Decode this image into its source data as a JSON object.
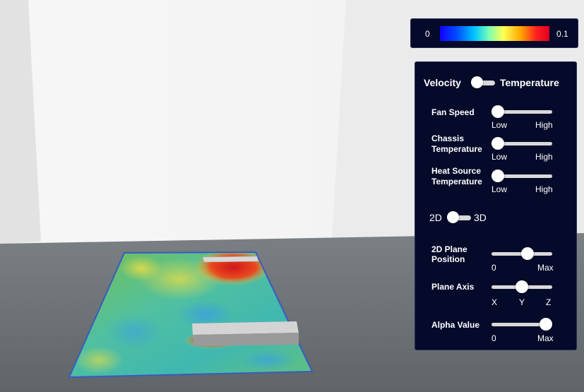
{
  "legend": {
    "min_label": "0",
    "max_label": "0.1"
  },
  "panel": {
    "mode_toggle": {
      "left_label": "Velocity",
      "right_label": "Temperature"
    },
    "fan_speed": {
      "label": "Fan Speed",
      "low": "Low",
      "high": "High",
      "value": 0.0
    },
    "chassis_temperature": {
      "label_line1": "Chassis",
      "label_line2": "Temperature",
      "low": "Low",
      "high": "High",
      "value": 0.0
    },
    "heat_source_temperature": {
      "label_line1": "Heat Source",
      "label_line2": "Temperature",
      "low": "Low",
      "high": "High",
      "value": 0.0
    },
    "dimension_toggle": {
      "left_label": "2D",
      "right_label": "3D"
    },
    "plane_position": {
      "label_line1": "2D Plane",
      "label_line2": "Position",
      "min": "0",
      "max": "Max",
      "value": 0.62
    },
    "plane_axis": {
      "label": "Plane Axis",
      "options": [
        "X",
        "Y",
        "Z"
      ],
      "selected": "Y"
    },
    "alpha_value": {
      "label": "Alpha Value",
      "min": "0",
      "max": "Max",
      "value": 1.0
    }
  },
  "colors": {
    "panel_bg": "#060a2a",
    "floor": "#6f7578",
    "wall": "#ececec"
  }
}
